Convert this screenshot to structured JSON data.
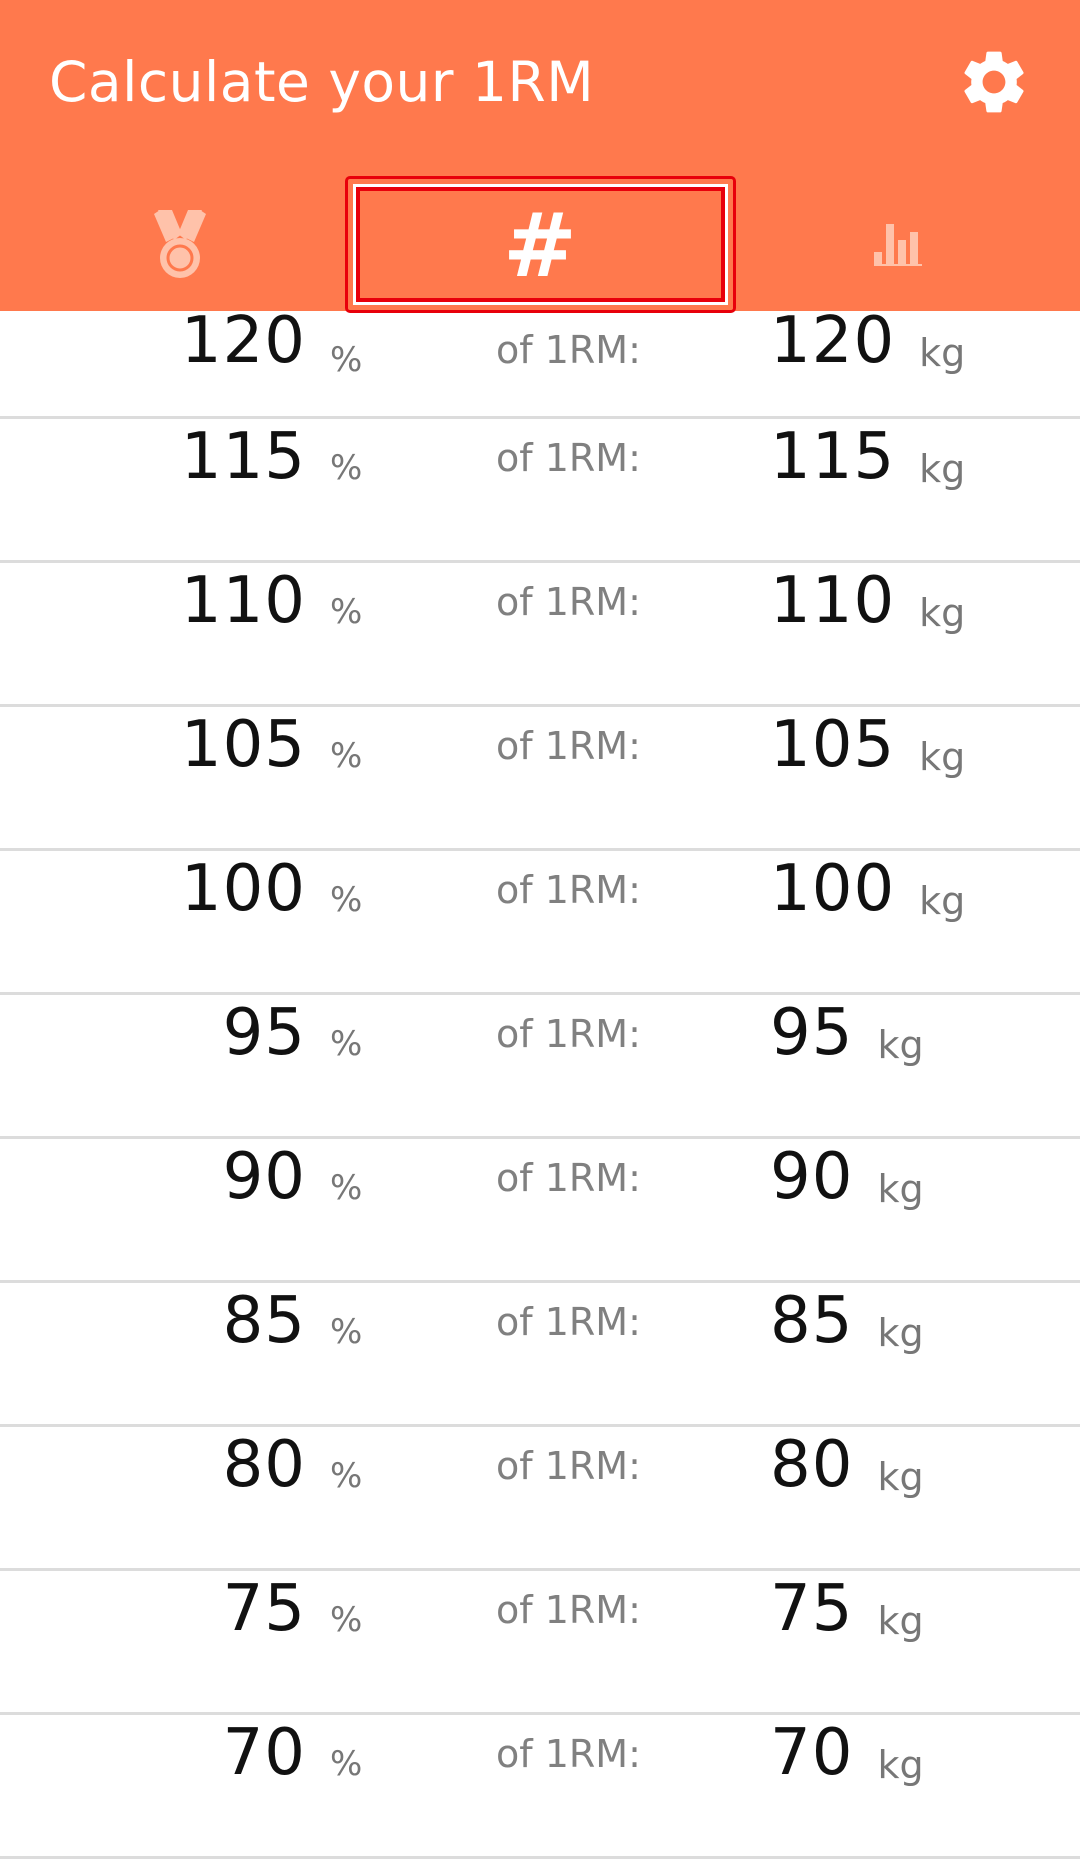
{
  "app_bar": {
    "title": "Calculate your 1RM",
    "settings_icon": "gear-icon"
  },
  "tabs": [
    {
      "icon": "medal-icon",
      "active": false
    },
    {
      "icon": "hash-icon",
      "glyph": "#",
      "active": true
    },
    {
      "icon": "bar-chart-icon",
      "active": false
    }
  ],
  "colors": {
    "primary": "#FF794D",
    "focus_outline": "#E8000B",
    "divider": "#DCDCDC"
  },
  "rows": [
    {
      "percent": "120",
      "percent_unit": "%",
      "label": "of 1RM:",
      "weight": "120",
      "weight_unit": "kg"
    },
    {
      "percent": "115",
      "percent_unit": "%",
      "label": "of 1RM:",
      "weight": "115",
      "weight_unit": "kg"
    },
    {
      "percent": "110",
      "percent_unit": "%",
      "label": "of 1RM:",
      "weight": "110",
      "weight_unit": "kg"
    },
    {
      "percent": "105",
      "percent_unit": "%",
      "label": "of 1RM:",
      "weight": "105",
      "weight_unit": "kg"
    },
    {
      "percent": "100",
      "percent_unit": "%",
      "label": "of 1RM:",
      "weight": "100",
      "weight_unit": "kg"
    },
    {
      "percent": "95",
      "percent_unit": "%",
      "label": "of 1RM:",
      "weight": "95",
      "weight_unit": "kg"
    },
    {
      "percent": "90",
      "percent_unit": "%",
      "label": "of 1RM:",
      "weight": "90",
      "weight_unit": "kg"
    },
    {
      "percent": "85",
      "percent_unit": "%",
      "label": "of 1RM:",
      "weight": "85",
      "weight_unit": "kg"
    },
    {
      "percent": "80",
      "percent_unit": "%",
      "label": "of 1RM:",
      "weight": "80",
      "weight_unit": "kg"
    },
    {
      "percent": "75",
      "percent_unit": "%",
      "label": "of 1RM:",
      "weight": "75",
      "weight_unit": "kg"
    },
    {
      "percent": "70",
      "percent_unit": "%",
      "label": "of 1RM:",
      "weight": "70",
      "weight_unit": "kg"
    }
  ]
}
